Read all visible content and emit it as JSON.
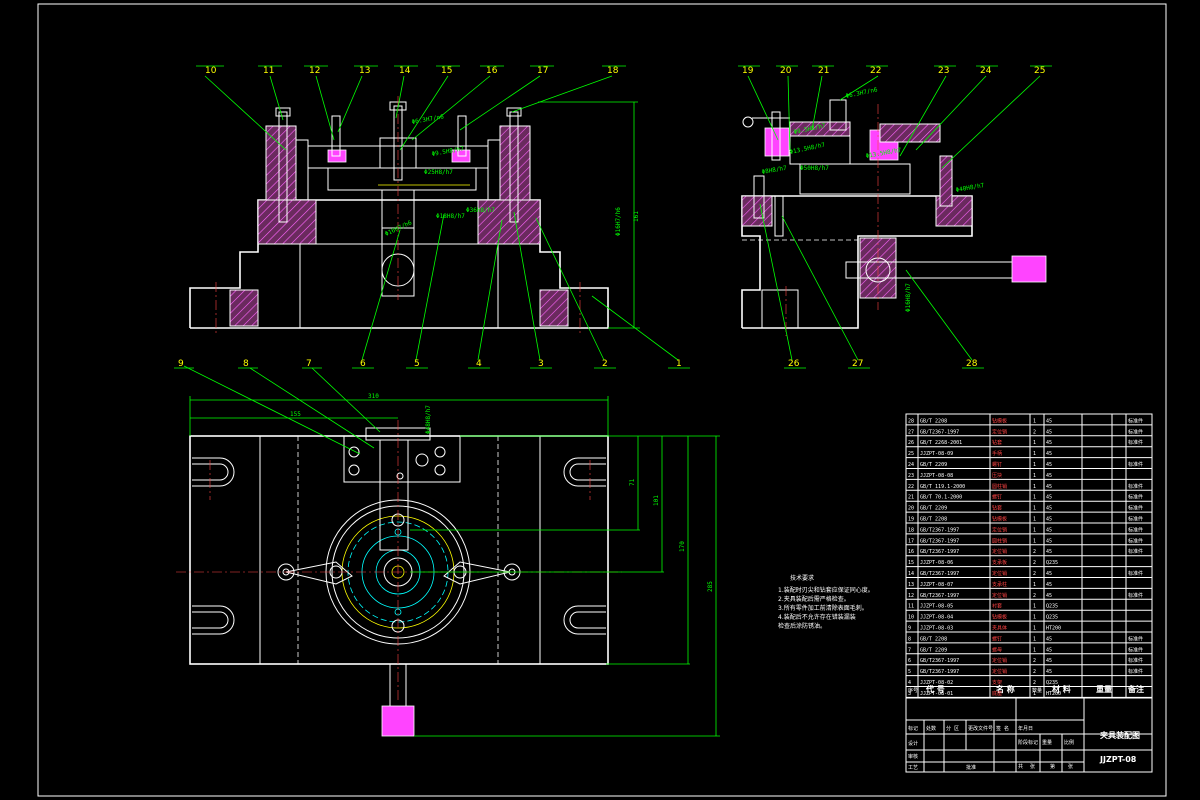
{
  "balloons_front": [
    "10",
    "11",
    "12",
    "13",
    "14",
    "15",
    "16",
    "17",
    "18",
    "6",
    "5",
    "4",
    "3",
    "2",
    "1"
  ],
  "balloons_side": [
    "19",
    "20",
    "21",
    "22",
    "23",
    "24",
    "25",
    "26",
    "27",
    "28"
  ],
  "balloons_plan": [
    "9",
    "8",
    "7"
  ],
  "dimensions": [
    "Φ6.3H7/n6",
    "Φ9.5H8/h7",
    "Φ25H8/h7",
    "Φ13.5H8/h7",
    "Φ36H8/h7",
    "Φ16H7/h6",
    "Φ18H8/h7",
    "Φ40H8/h7",
    "Φ16H8/h7",
    "Φ50H8/h7",
    "Φ8H8/h7",
    "Φ48H8/h7",
    "161",
    "310",
    "155",
    "71",
    "101",
    "170",
    "285"
  ],
  "tech_notes": {
    "title": "技术要求",
    "lines": [
      "1.装配时刃尖和钻套应保证同心度。",
      "2.夹具装配后需严格检查。",
      "3.所有零件加工前清除表面毛刺。",
      "4.装配后不允许存在错装漏装",
      "检查后涂防锈油。"
    ]
  },
  "parts_list": [
    [
      "28",
      "GB/T 2208",
      "钻模板",
      "1",
      "45",
      "标准件"
    ],
    [
      "27",
      "GB/T2367-1997",
      "定位销",
      "2",
      "45",
      "标准件"
    ],
    [
      "26",
      "GB/T 2268-2001",
      "钻套",
      "1",
      "45",
      "标准件"
    ],
    [
      "25",
      "JJZPT-08-09",
      "手柄",
      "1",
      "45",
      ""
    ],
    [
      "24",
      "GB/T 2209",
      "螺钉",
      "1",
      "45",
      "标准件"
    ],
    [
      "23",
      "JJZPT-08-08",
      "压块",
      "1",
      "45",
      ""
    ],
    [
      "22",
      "GB/T 119.1-2000",
      "圆柱销",
      "1",
      "45",
      "标准件"
    ],
    [
      "21",
      "GB/T 70.1-2000",
      "螺钉",
      "1",
      "45",
      "标准件"
    ],
    [
      "20",
      "GB/T 2209",
      "钻套",
      "1",
      "45",
      "标准件"
    ],
    [
      "19",
      "GB/T 2208",
      "钻模板",
      "1",
      "45",
      "标准件"
    ],
    [
      "18",
      "GB/T2367-1997",
      "定位销",
      "1",
      "45",
      "标准件"
    ],
    [
      "17",
      "GB/T2367-1997",
      "圆柱销",
      "1",
      "45",
      "标准件"
    ],
    [
      "16",
      "GB/T2367-1997",
      "定位销",
      "2",
      "45",
      "标准件"
    ],
    [
      "15",
      "JJZPT-08-06",
      "支承板",
      "2",
      "Q235",
      ""
    ],
    [
      "14",
      "GB/T2367-1997",
      "定位销",
      "2",
      "45",
      "标准件"
    ],
    [
      "13",
      "JJZPT-08-07",
      "支承柱",
      "1",
      "45",
      ""
    ],
    [
      "12",
      "GB/T2367-1997",
      "定位销",
      "2",
      "45",
      "标准件"
    ],
    [
      "11",
      "JJZPT-08-05",
      "衬套",
      "1",
      "Q235",
      ""
    ],
    [
      "10",
      "JJZPT-08-04",
      "钻模板",
      "1",
      "Q235",
      ""
    ],
    [
      "9",
      "JJZPT-08-03",
      "夹具体",
      "1",
      "HT200",
      ""
    ],
    [
      "8",
      "GB/T 2208",
      "螺钉",
      "1",
      "45",
      "标准件"
    ],
    [
      "7",
      "GB/T 2209",
      "螺母",
      "1",
      "45",
      "标准件"
    ],
    [
      "6",
      "GB/T2367-1997",
      "定位销",
      "2",
      "45",
      "标准件"
    ],
    [
      "5",
      "GB/T2367-1997",
      "定位销",
      "2",
      "45",
      "标准件"
    ],
    [
      "4",
      "JJZPT-08-02",
      "支架",
      "2",
      "Q235",
      ""
    ],
    [
      "3",
      "JJZPT-08-01",
      "底座",
      "1",
      "HT200",
      ""
    ]
  ],
  "parts_header": [
    "序号",
    "代 号",
    "名 称",
    "数量",
    "材 料",
    "重量",
    "备注"
  ],
  "title_block": {
    "name": "夹具装配图",
    "drawing_no": "JJZPT-08",
    "rows": [
      "标记",
      "处数",
      "分 区",
      "更改文件号",
      "签 名",
      "年月日",
      "设计",
      "审核",
      "工艺",
      "批准",
      "阶段标记",
      "重量",
      "比例",
      "共",
      "张",
      "第",
      "张"
    ]
  }
}
